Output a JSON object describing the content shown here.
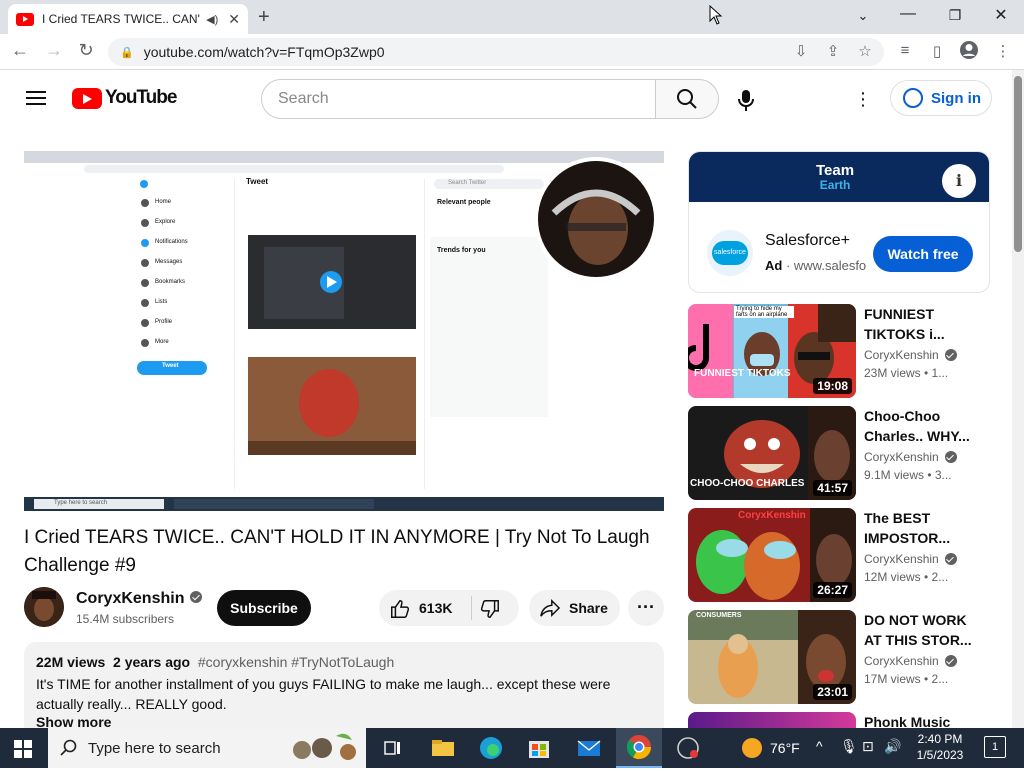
{
  "browser": {
    "tab_title": "I Cried TEARS TWICE.. CAN'T",
    "url": "youtube.com/watch?v=FTqmOp3Zwp0"
  },
  "youtube": {
    "logo_text": "YouTube",
    "search_placeholder": "Search",
    "signin_label": "Sign in"
  },
  "video": {
    "title": "I Cried TEARS TWICE.. CAN'T HOLD IT IN ANYMORE | Try Not To Laugh Challenge #9",
    "channel_name": "CoryxKenshin",
    "subscribers": "15.4M subscribers",
    "subscribe_label": "Subscribe",
    "likes": "613K",
    "share_label": "Share",
    "views": "22M views",
    "age": "2 years ago",
    "tags": "#coryxkenshin #TryNotToLaugh",
    "description": "It's TIME for another installment of you guys FAILING to make me laugh... except these were actually really... REALLY good.",
    "show_more": "Show more"
  },
  "player_content": {
    "tweet_header": "Tweet",
    "nav": [
      "Home",
      "Explore",
      "Notifications",
      "Messages",
      "Bookmarks",
      "Lists",
      "Profile",
      "More"
    ],
    "tweet_button": "Tweet",
    "search_twitter": "Search Twitter",
    "relevant_people": "Relevant people",
    "trends_title": "Trends for you",
    "search_here": "Type here to search"
  },
  "ad": {
    "banner_line1": "Team",
    "banner_line2": "Earth",
    "logo_text": "salesforce",
    "title": "Salesforce+",
    "ad_badge": "Ad",
    "domain": "www.salesfo",
    "button": "Watch free"
  },
  "recommendations": [
    {
      "title": "FUNNIEST TIKTOKS i...",
      "channel": "CoryxKenshin",
      "meta": "23M views • 1...",
      "duration": "19:08",
      "thumb_text": "FUNNIEST TIKTOKS",
      "caption": "Trying to hide my farts on an airplane"
    },
    {
      "title": "Choo-Choo Charles.. WHY...",
      "channel": "CoryxKenshin",
      "meta": "9.1M views • 3...",
      "duration": "41:57",
      "thumb_text": "CHOO-CHOO CHARLES"
    },
    {
      "title": "The BEST IMPOSTOR...",
      "channel": "CoryxKenshin",
      "meta": "12M views • 2...",
      "duration": "26:27",
      "thumb_text": "CoryxKenshin"
    },
    {
      "title": "DO NOT WORK AT THIS STOR...",
      "channel": "CoryxKenshin",
      "meta": "17M views • 2...",
      "duration": "23:01",
      "thumb_text": "CONSUMERS"
    },
    {
      "title": "Phonk Music"
    }
  ],
  "taskbar": {
    "search_placeholder": "Type here to search",
    "temperature": "76°F",
    "time": "2:40 PM",
    "date": "1/5/2023",
    "notification_count": "1"
  },
  "colors": {
    "youtube_red": "#ff0000",
    "link_blue": "#065fd4",
    "ad_banner": "#0a2a5e",
    "taskbar": "#1f2b3a"
  }
}
